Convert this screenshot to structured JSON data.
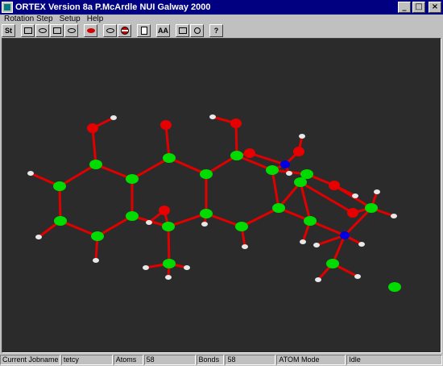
{
  "window": {
    "title": "ORTEX Version 8a P.McArdle NUI Galway 2000"
  },
  "window_controls": {
    "minimize": "_",
    "maximize": "□",
    "close": "×"
  },
  "menu": {
    "items": [
      "Rotation Step",
      "Setup",
      "Help"
    ]
  },
  "toolbar": {
    "st_label": "St",
    "aa_label": "AA",
    "help_label": "?"
  },
  "status": {
    "jobname_label": "Current Jobname",
    "jobname_value": "tetcy",
    "atoms_label": "Atoms",
    "atoms_value": "58",
    "bonds_label": "Bonds",
    "bonds_value": "58",
    "mode": "ATOM Mode",
    "state": "Idle"
  },
  "colors": {
    "titlebar": "#000080",
    "background": "#2b2b2b",
    "bond": "#e00000",
    "carbon": "#00dc00",
    "oxygen": "#e80000",
    "hydrogen": "#e8e8e8",
    "nitrogen": "#0000e0"
  }
}
